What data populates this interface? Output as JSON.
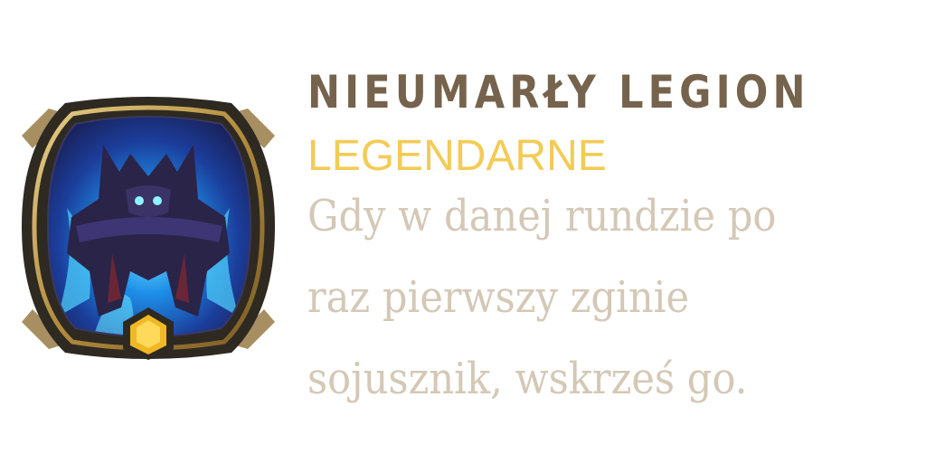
{
  "card": {
    "title": "NIEUMARŁY LEGION",
    "rarity": "LEGENDARNE",
    "description_lines": [
      "Gdy w danej rundzie po",
      "raz pierwszy zginie",
      "sojusznik, wskrześ go."
    ]
  },
  "colors": {
    "title": "#76634d",
    "rarity": "#f3cb55",
    "description": "#d4c8b6",
    "frame_gold": "#c9a75a",
    "frame_dark": "#2e2a22",
    "art_blue": "#2fa6ff",
    "gem": "#f1b825"
  },
  "icons": {
    "badge": "undead-legion-icon",
    "gem": "hexagon-gem-icon"
  }
}
